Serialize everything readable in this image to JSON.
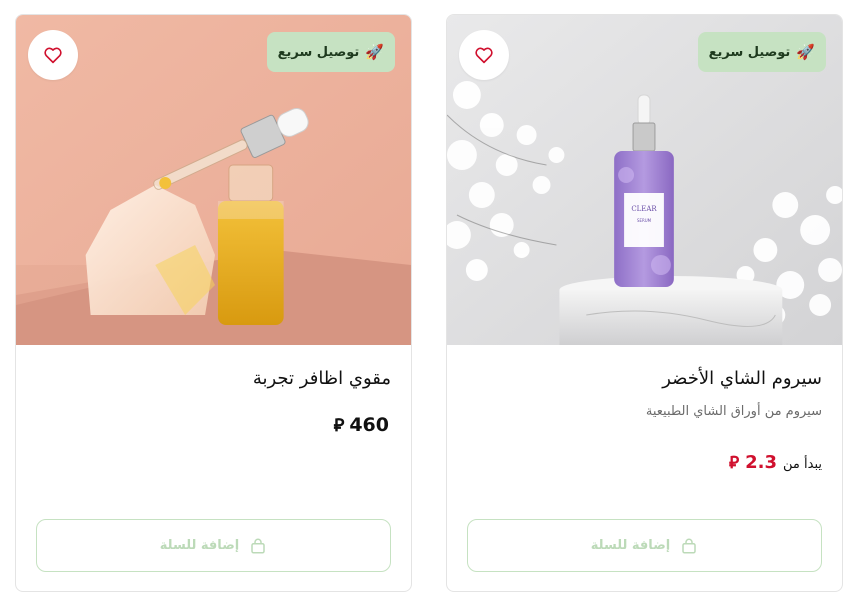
{
  "products": [
    {
      "title": "سيروم الشاي الأخضر",
      "subtitle": "سيروم من أوراق الشاي الطبيعية",
      "price_prefix": "يبدأ من",
      "price": "2.3",
      "currency": "⃁",
      "badge": "توصيل سريع",
      "badge_icon": "rocket-icon",
      "add_to_cart": "إضافة للسلة",
      "bottle_brand": "CLEAR",
      "bottle_label": "SERUM",
      "price_color": "#d0102e"
    },
    {
      "title": "مقوي اظافر تجربة",
      "price": "460",
      "currency": "⃁",
      "badge": "توصيل سريع",
      "badge_icon": "rocket-icon",
      "add_to_cart": "إضافة للسلة"
    }
  ],
  "colors": {
    "badge_bg": "#c6e2c2",
    "button_border": "#c6e2c2",
    "button_text": "#bcdab8",
    "heart": "#d0102e"
  }
}
